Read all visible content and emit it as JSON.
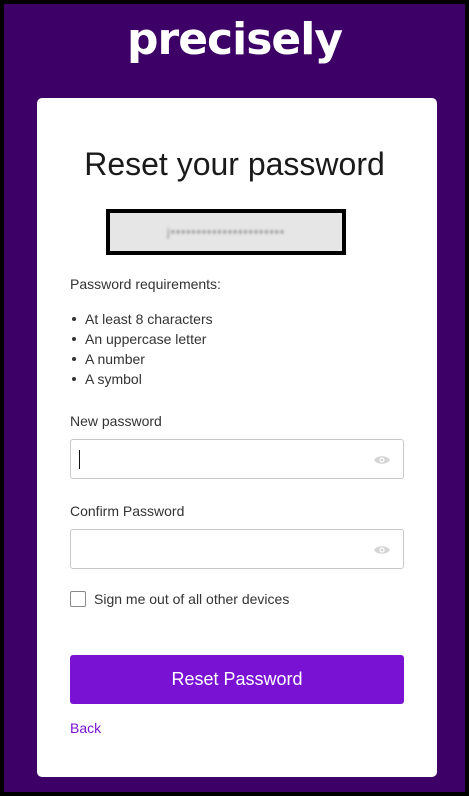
{
  "header": {
    "logo_text": "precisely"
  },
  "card": {
    "title": "Reset your password",
    "email_redacted": "j••••••••••••••••••••••"
  },
  "requirements": {
    "title": "Password requirements:",
    "items": [
      "At least 8 characters",
      "An uppercase letter",
      "A number",
      "A symbol"
    ]
  },
  "new_password": {
    "label": "New password",
    "value": "",
    "icon": "eye-icon"
  },
  "confirm_password": {
    "label": "Confirm Password",
    "value": "",
    "icon": "eye-icon"
  },
  "sign_out": {
    "label": "Sign me out of all other devices",
    "checked": false
  },
  "actions": {
    "submit_label": "Reset Password",
    "back_label": "Back"
  },
  "colors": {
    "background": "#3d0066",
    "primary": "#7a12d4",
    "card": "#ffffff"
  }
}
